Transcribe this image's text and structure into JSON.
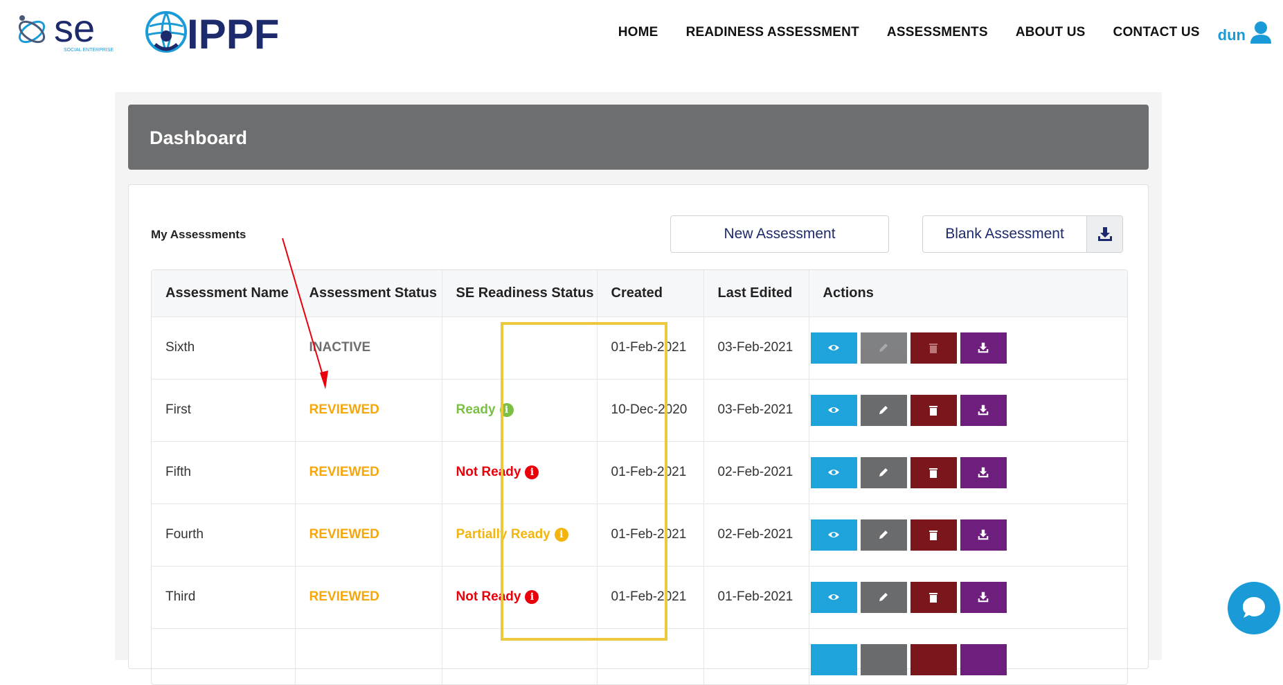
{
  "header": {
    "logo_se_alt": "SOCIAL ENTERPRISE",
    "logo_se_text": "se",
    "logo_se_tagline": "SOCIAL ENTERPRISE",
    "logo_ippf_text": "IPPF",
    "nav": [
      {
        "label": "HOME"
      },
      {
        "label": "READINESS ASSESSMENT"
      },
      {
        "label": "ASSESSMENTS"
      },
      {
        "label": "ABOUT US"
      },
      {
        "label": "CONTACT US"
      }
    ],
    "user_name": "dun"
  },
  "dashboard": {
    "title": "Dashboard",
    "section_title": "My Assessments",
    "new_button": "New Assessment",
    "blank_button": "Blank Assessment"
  },
  "table": {
    "columns": [
      "Assessment Name",
      "Assessment Status",
      "SE Readiness Status",
      "Created",
      "Last Edited",
      "Actions"
    ],
    "rows": [
      {
        "name": "Sixth",
        "status": "INACTIVE",
        "readiness": "",
        "created": "01-Feb-2021",
        "edited": "03-Feb-2021"
      },
      {
        "name": "First",
        "status": "REVIEWED",
        "readiness": "Ready",
        "created": "10-Dec-2020",
        "edited": "03-Feb-2021"
      },
      {
        "name": "Fifth",
        "status": "REVIEWED",
        "readiness": "Not Ready",
        "created": "01-Feb-2021",
        "edited": "02-Feb-2021"
      },
      {
        "name": "Fourth",
        "status": "REVIEWED",
        "readiness": "Partially Ready",
        "created": "01-Feb-2021",
        "edited": "02-Feb-2021"
      },
      {
        "name": "Third",
        "status": "REVIEWED",
        "readiness": "Not Ready",
        "created": "01-Feb-2021",
        "edited": "01-Feb-2021"
      }
    ]
  },
  "colors": {
    "accent_blue": "#1ea3db",
    "ready": "#79c043",
    "not_ready": "#e8000b",
    "partially_ready": "#f3b50d",
    "reviewed": "#f5a70b",
    "delete": "#7a161c",
    "download": "#6e1f7e"
  },
  "icons": {
    "user": "user-icon",
    "blank_download": "download-icon",
    "view": "eye-icon",
    "edit": "pencil-icon",
    "delete": "trash-icon",
    "download": "download-icon",
    "info": "info-icon",
    "chat": "chat-icon"
  }
}
